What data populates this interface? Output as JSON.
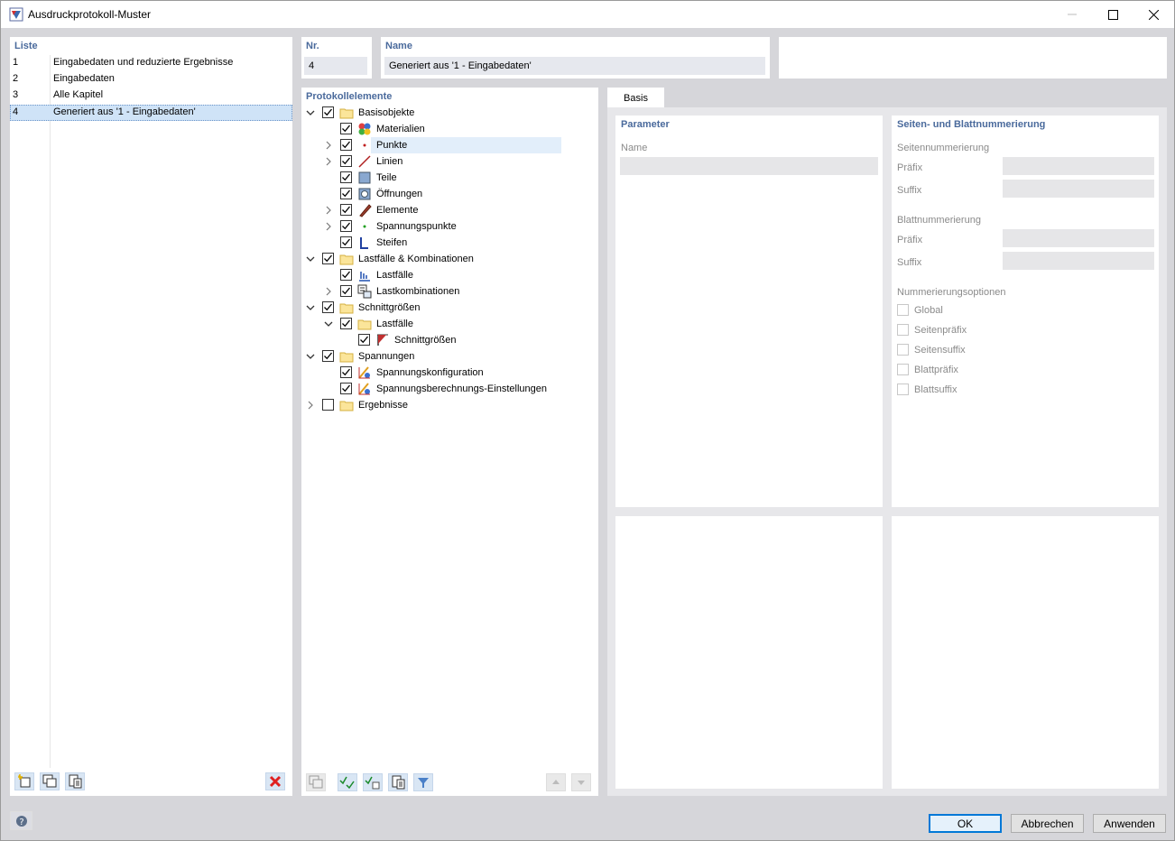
{
  "window": {
    "title": "Ausdruckprotokoll-Muster"
  },
  "list": {
    "header": "Liste",
    "items": [
      {
        "num": "1",
        "label": "Eingabedaten und reduzierte Ergebnisse"
      },
      {
        "num": "2",
        "label": "Eingabedaten"
      },
      {
        "num": "3",
        "label": "Alle Kapitel"
      },
      {
        "num": "4",
        "label": "Generiert aus '1 - Eingabedaten'"
      }
    ]
  },
  "nr": {
    "header": "Nr.",
    "value": "4"
  },
  "name": {
    "header": "Name",
    "value": "Generiert aus '1 - Eingabedaten'"
  },
  "tree": {
    "header": "Protokollelemente",
    "items": [
      {
        "label": "Basisobjekte",
        "level": 0,
        "expander": "down",
        "checked": true,
        "icon": "folder-icon"
      },
      {
        "label": "Materialien",
        "level": 1,
        "expander": "none",
        "checked": true,
        "icon": "materials-icon"
      },
      {
        "label": "Punkte",
        "level": 1,
        "expander": "right",
        "checked": true,
        "icon": "point-icon"
      },
      {
        "label": "Linien",
        "level": 1,
        "expander": "right",
        "checked": true,
        "icon": "line-icon"
      },
      {
        "label": "Teile",
        "level": 1,
        "expander": "none",
        "checked": true,
        "icon": "part-icon"
      },
      {
        "label": "Öffnungen",
        "level": 1,
        "expander": "none",
        "checked": true,
        "icon": "opening-icon"
      },
      {
        "label": "Elemente",
        "level": 1,
        "expander": "right",
        "checked": true,
        "icon": "element-icon"
      },
      {
        "label": "Spannungspunkte",
        "level": 1,
        "expander": "right",
        "checked": true,
        "icon": "stress-point-icon"
      },
      {
        "label": "Steifen",
        "level": 1,
        "expander": "none",
        "checked": true,
        "icon": "stiffener-icon"
      },
      {
        "label": "Lastfälle & Kombinationen",
        "level": 0,
        "expander": "down",
        "checked": true,
        "icon": "folder-icon"
      },
      {
        "label": "Lastfälle",
        "level": 1,
        "expander": "none",
        "checked": true,
        "icon": "load-case-icon"
      },
      {
        "label": "Lastkombinationen",
        "level": 1,
        "expander": "right",
        "checked": true,
        "icon": "load-combination-icon"
      },
      {
        "label": "Schnittgrößen",
        "level": 0,
        "expander": "down",
        "checked": true,
        "icon": "folder-icon"
      },
      {
        "label": "Lastfälle",
        "level": 1,
        "expander": "down",
        "checked": true,
        "icon": "folder-icon"
      },
      {
        "label": "Schnittgrößen",
        "level": 2,
        "expander": "none",
        "checked": true,
        "icon": "internal-forces-icon"
      },
      {
        "label": "Spannungen",
        "level": 0,
        "expander": "down",
        "checked": true,
        "icon": "folder-icon"
      },
      {
        "label": "Spannungskonfiguration",
        "level": 1,
        "expander": "none",
        "checked": true,
        "icon": "stress-config-icon"
      },
      {
        "label": "Spannungsberechnungs-Einstellungen",
        "level": 1,
        "expander": "none",
        "checked": true,
        "icon": "stress-settings-icon"
      },
      {
        "label": "Ergebnisse",
        "level": 0,
        "expander": "right",
        "checked": false,
        "icon": "folder-icon"
      }
    ]
  },
  "tabs": {
    "basis": "Basis"
  },
  "parameter": {
    "header": "Parameter",
    "name_label": "Name"
  },
  "numbering": {
    "header": "Seiten- und Blattnummerierung",
    "page_header": "Seitennummerierung",
    "prefix": "Präfix",
    "suffix": "Suffix",
    "sheet_header": "Blattnummerierung",
    "sheet_prefix": "Präfix",
    "sheet_suffix": "Suffix",
    "options_header": "Nummerierungsoptionen",
    "options": [
      "Global",
      "Seitenpräfix",
      "Seitensuffix",
      "Blattpräfix",
      "Blattsuffix"
    ]
  },
  "footer": {
    "ok": "OK",
    "cancel": "Abbrechen",
    "apply": "Anwenden"
  }
}
